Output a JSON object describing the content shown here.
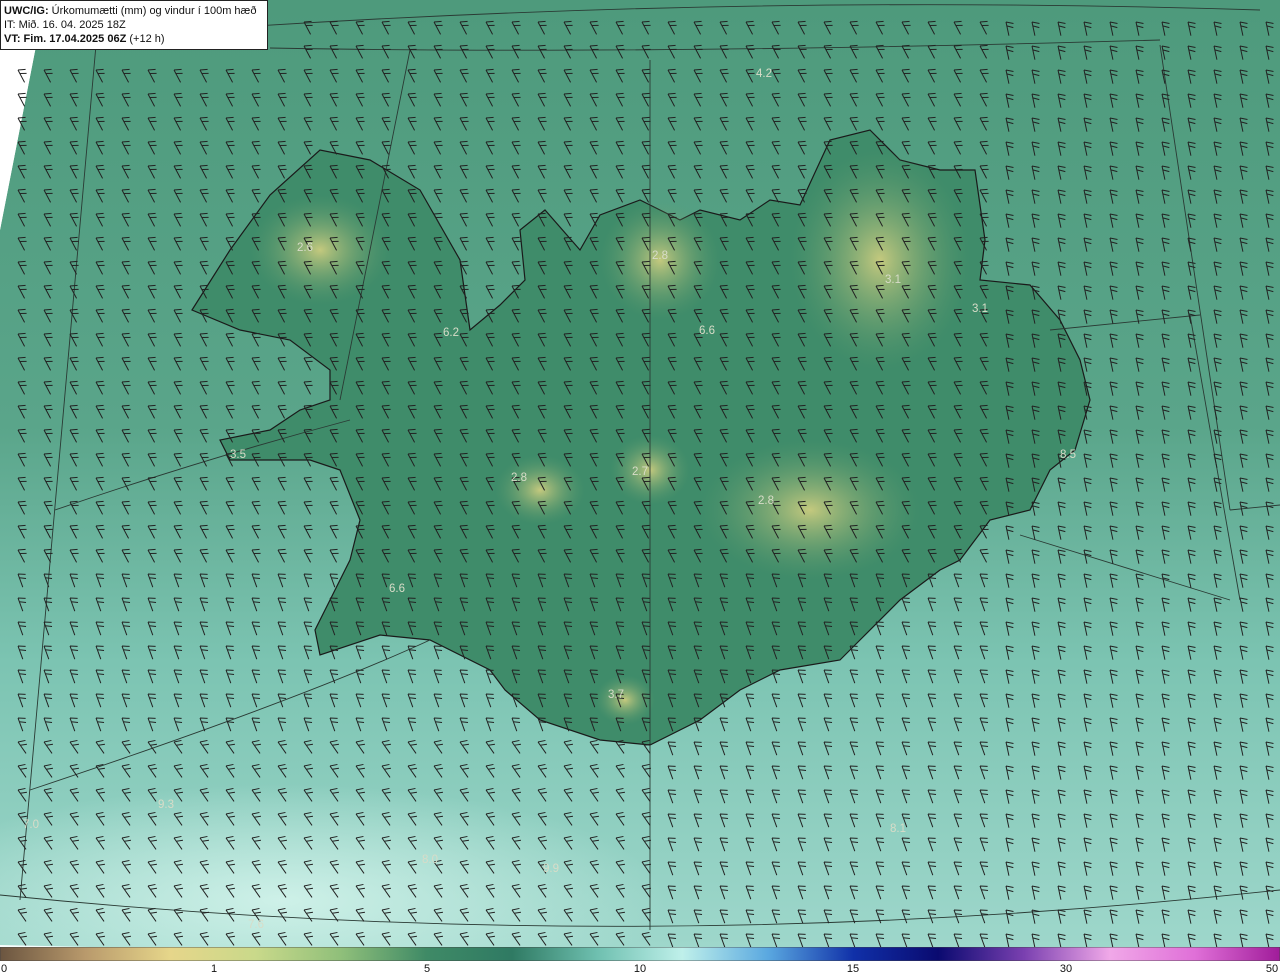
{
  "header": {
    "source": "UWC/IG:",
    "title": "Úrkomumætti (mm) og vindur í 100m hæð",
    "issue_time": "IT: Mið. 16. 04. 2025 18Z",
    "valid_prefix": "VT: Fim. 17.04.2025 06Z",
    "valid_suffix": "(+12 h)"
  },
  "map_labels": [
    {
      "text": "4.2"
    },
    {
      "text": "2.6"
    },
    {
      "text": "6.2"
    },
    {
      "text": "2.8"
    },
    {
      "text": "6.6"
    },
    {
      "text": "3.1"
    },
    {
      "text": "3.1"
    },
    {
      "text": "3.5"
    },
    {
      "text": "2.8"
    },
    {
      "text": "2.7"
    },
    {
      "text": "2.8"
    },
    {
      "text": "6.6"
    },
    {
      "text": "3.7"
    },
    {
      "text": "7.0"
    },
    {
      "text": "9.3"
    },
    {
      "text": "8.0"
    },
    {
      "text": "9.9"
    },
    {
      "text": "8.1"
    },
    {
      "text": "8.5"
    },
    {
      "text": "7.6"
    }
  ],
  "colorbar": {
    "ticks": [
      "0",
      "1",
      "5",
      "10",
      "15",
      "30",
      "50"
    ],
    "colors": [
      "#6b5540",
      "#b99a6c",
      "#e6d68a",
      "#c9d98a",
      "#8fbf7a",
      "#3f8a66",
      "#2f7a63",
      "#6fc0b0",
      "#bff0ea",
      "#5aa8e0",
      "#1030a8",
      "#0a0a70",
      "#7a40b0",
      "#f0a8e8",
      "#e070d8",
      "#a01c9a"
    ]
  },
  "palette": {
    "ocean_light": "#9fd6cc",
    "ocean_dark": "#4f9e88",
    "land_green": "#3e8a68",
    "land_yellow": "#b3c27a"
  }
}
